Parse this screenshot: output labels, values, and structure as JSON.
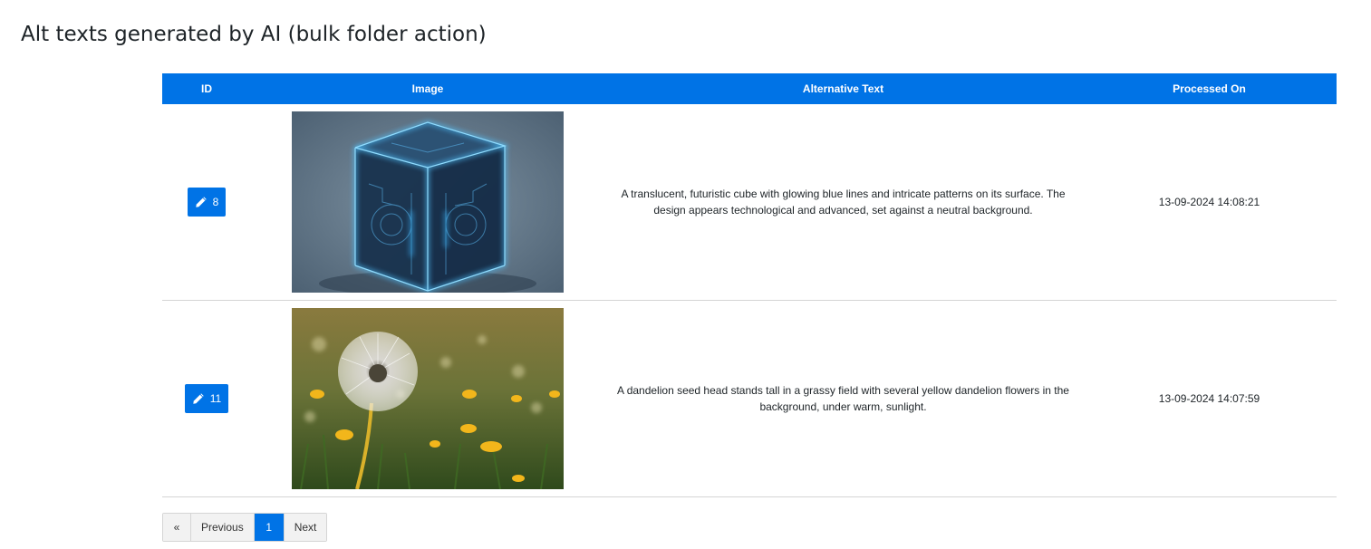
{
  "page": {
    "title": "Alt texts generated by AI (bulk folder action)"
  },
  "table": {
    "headers": {
      "id": "ID",
      "image": "Image",
      "alt_text": "Alternative Text",
      "processed_on": "Processed On"
    },
    "rows": [
      {
        "id": "8",
        "image_icon": "glowing-cube-image",
        "alt_text": "A translucent, futuristic cube with glowing blue lines and intricate patterns on its surface. The design appears technological and advanced, set against a neutral background.",
        "processed_on": "13-09-2024 14:08:21"
      },
      {
        "id": "11",
        "image_icon": "dandelion-image",
        "alt_text": "A dandelion seed head stands tall in a grassy field with several yellow dandelion flowers in the background, under warm, sunlight.",
        "processed_on": "13-09-2024 14:07:59"
      }
    ]
  },
  "pagination": {
    "first": "«",
    "previous": "Previous",
    "current": "1",
    "next": "Next"
  },
  "colors": {
    "accent": "#0073e6",
    "border": "#d5d5d5"
  }
}
